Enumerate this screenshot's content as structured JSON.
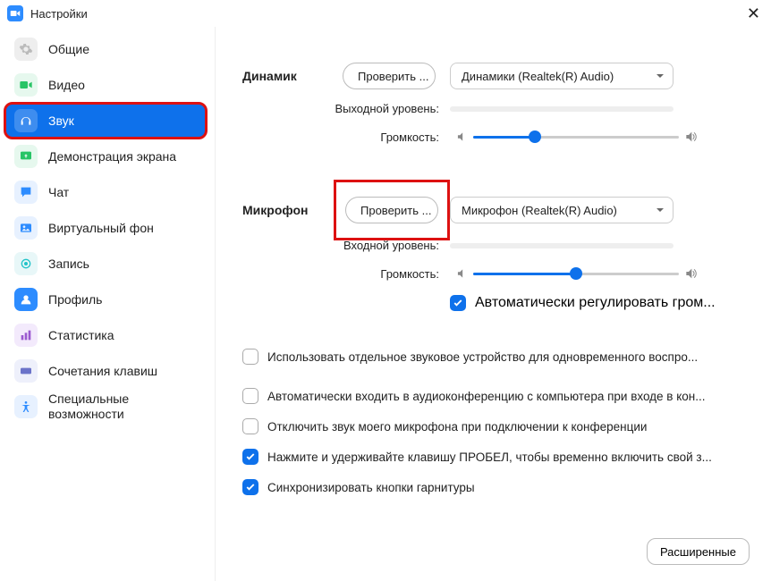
{
  "window": {
    "title": "Настройки"
  },
  "sidebar": {
    "items": [
      {
        "label": "Общие",
        "icon": "gear",
        "bg": "#eeeeee",
        "fg": "#bbbbbb"
      },
      {
        "label": "Видео",
        "icon": "video",
        "bg": "#e6f8ee",
        "fg": "#28c466"
      },
      {
        "label": "Звук",
        "icon": "headphones",
        "active": true
      },
      {
        "label": "Демонстрация экрана",
        "icon": "share",
        "bg": "#e6f8ee",
        "fg": "#28c466"
      },
      {
        "label": "Чат",
        "icon": "chat",
        "bg": "#e7f1ff",
        "fg": "#2d8cff"
      },
      {
        "label": "Виртуальный фон",
        "icon": "vbg",
        "bg": "#e7f1ff",
        "fg": "#2d8cff"
      },
      {
        "label": "Запись",
        "icon": "record",
        "bg": "#e8f7f8",
        "fg": "#22c3c9"
      },
      {
        "label": "Профиль",
        "icon": "profile",
        "bg": "#e7f1ff",
        "fg": "#2d8cff"
      },
      {
        "label": "Статистика",
        "icon": "stats",
        "bg": "#f3eafc",
        "fg": "#9b59d0"
      },
      {
        "label": "Сочетания клавиш",
        "icon": "keyboard",
        "bg": "#eef0fb",
        "fg": "#6b73c9"
      },
      {
        "label": "Специальные возможности",
        "icon": "access",
        "bg": "#e7f1ff",
        "fg": "#2d8cff"
      }
    ]
  },
  "speaker": {
    "section": "Динамик",
    "test": "Проверить ...",
    "device": "Динамики (Realtek(R) Audio)",
    "output_label": "Выходной уровень:",
    "volume_label": "Громкость:",
    "volume_pct": 30
  },
  "mic": {
    "section": "Микрофон",
    "test": "Проверить ...",
    "device": "Микрофон (Realtek(R) Audio)",
    "input_label": "Входной уровень:",
    "volume_label": "Громкость:",
    "volume_pct": 50,
    "auto_adjust": "Автоматически регулировать гром..."
  },
  "options": {
    "separate_device": {
      "checked": false,
      "label": "Использовать отдельное звуковое устройство для одновременного воспро..."
    },
    "auto_join": {
      "checked": false,
      "label": "Автоматически входить в аудиоконференцию с компьютера при входе в кон..."
    },
    "mute_on_join": {
      "checked": false,
      "label": "Отключить звук моего микрофона при подключении к конференции"
    },
    "push_to_talk": {
      "checked": true,
      "label": "Нажмите и удерживайте клавишу ПРОБЕЛ, чтобы временно включить свой з..."
    },
    "sync_headset": {
      "checked": true,
      "label": "Синхронизировать кнопки гарнитуры"
    }
  },
  "advanced": "Расширенные"
}
